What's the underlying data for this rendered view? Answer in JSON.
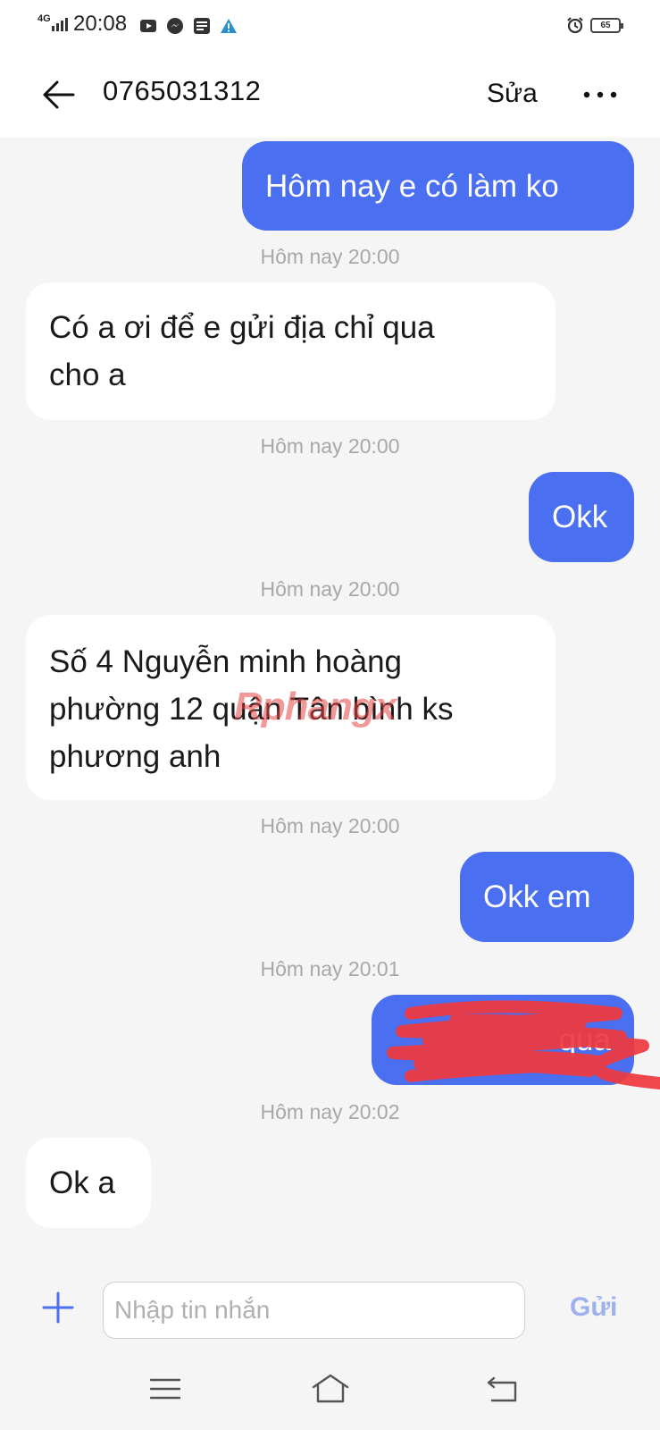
{
  "status_bar": {
    "network": "4G",
    "time": "20:08",
    "battery": "65",
    "icons": [
      "youtube-icon",
      "messenger-icon",
      "baomoi-icon",
      "warning-icon",
      "alarm-icon",
      "battery-icon"
    ]
  },
  "header": {
    "contact": "0765031312",
    "edit_label": "Sửa",
    "back_icon": "arrow-left-icon",
    "more_icon": "more-horizontal-icon"
  },
  "messages": [
    {
      "direction": "outgoing",
      "text": "Hôm nay e có làm ko"
    },
    {
      "timestamp": "Hôm nay 20:00"
    },
    {
      "direction": "incoming",
      "lines": [
        "Có a ơi để e gửi địa chỉ qua",
        "cho a"
      ]
    },
    {
      "timestamp": "Hôm nay 20:00"
    },
    {
      "direction": "outgoing",
      "text": "Okk"
    },
    {
      "timestamp": "Hôm nay 20:00"
    },
    {
      "direction": "incoming",
      "lines": [
        "Số 4 Nguyễn minh hoàng",
        "phường 12 quận Tân bình ks",
        "phương anh"
      ]
    },
    {
      "timestamp": "Hôm nay 20:00"
    },
    {
      "direction": "outgoing",
      "text": "Okk em"
    },
    {
      "timestamp": "Hôm nay 20:01"
    },
    {
      "direction": "outgoing",
      "text": "qua",
      "redacted": true
    },
    {
      "timestamp": "Hôm nay 20:02"
    },
    {
      "direction": "incoming",
      "text": "Ok a"
    }
  ],
  "watermark": "Rphangx",
  "composer": {
    "placeholder": "Nhập tin nhắn",
    "send_label": "Gửi",
    "attach_icon": "plus-icon"
  },
  "nav_bar": {
    "icons": [
      "menu-icon",
      "home-icon",
      "back-icon"
    ]
  },
  "colors": {
    "outgoing_bubble": "#4a6ff0",
    "incoming_bubble": "#ffffff",
    "timestamp": "#a8a8a8",
    "send_disabled": "#9db1ef"
  }
}
